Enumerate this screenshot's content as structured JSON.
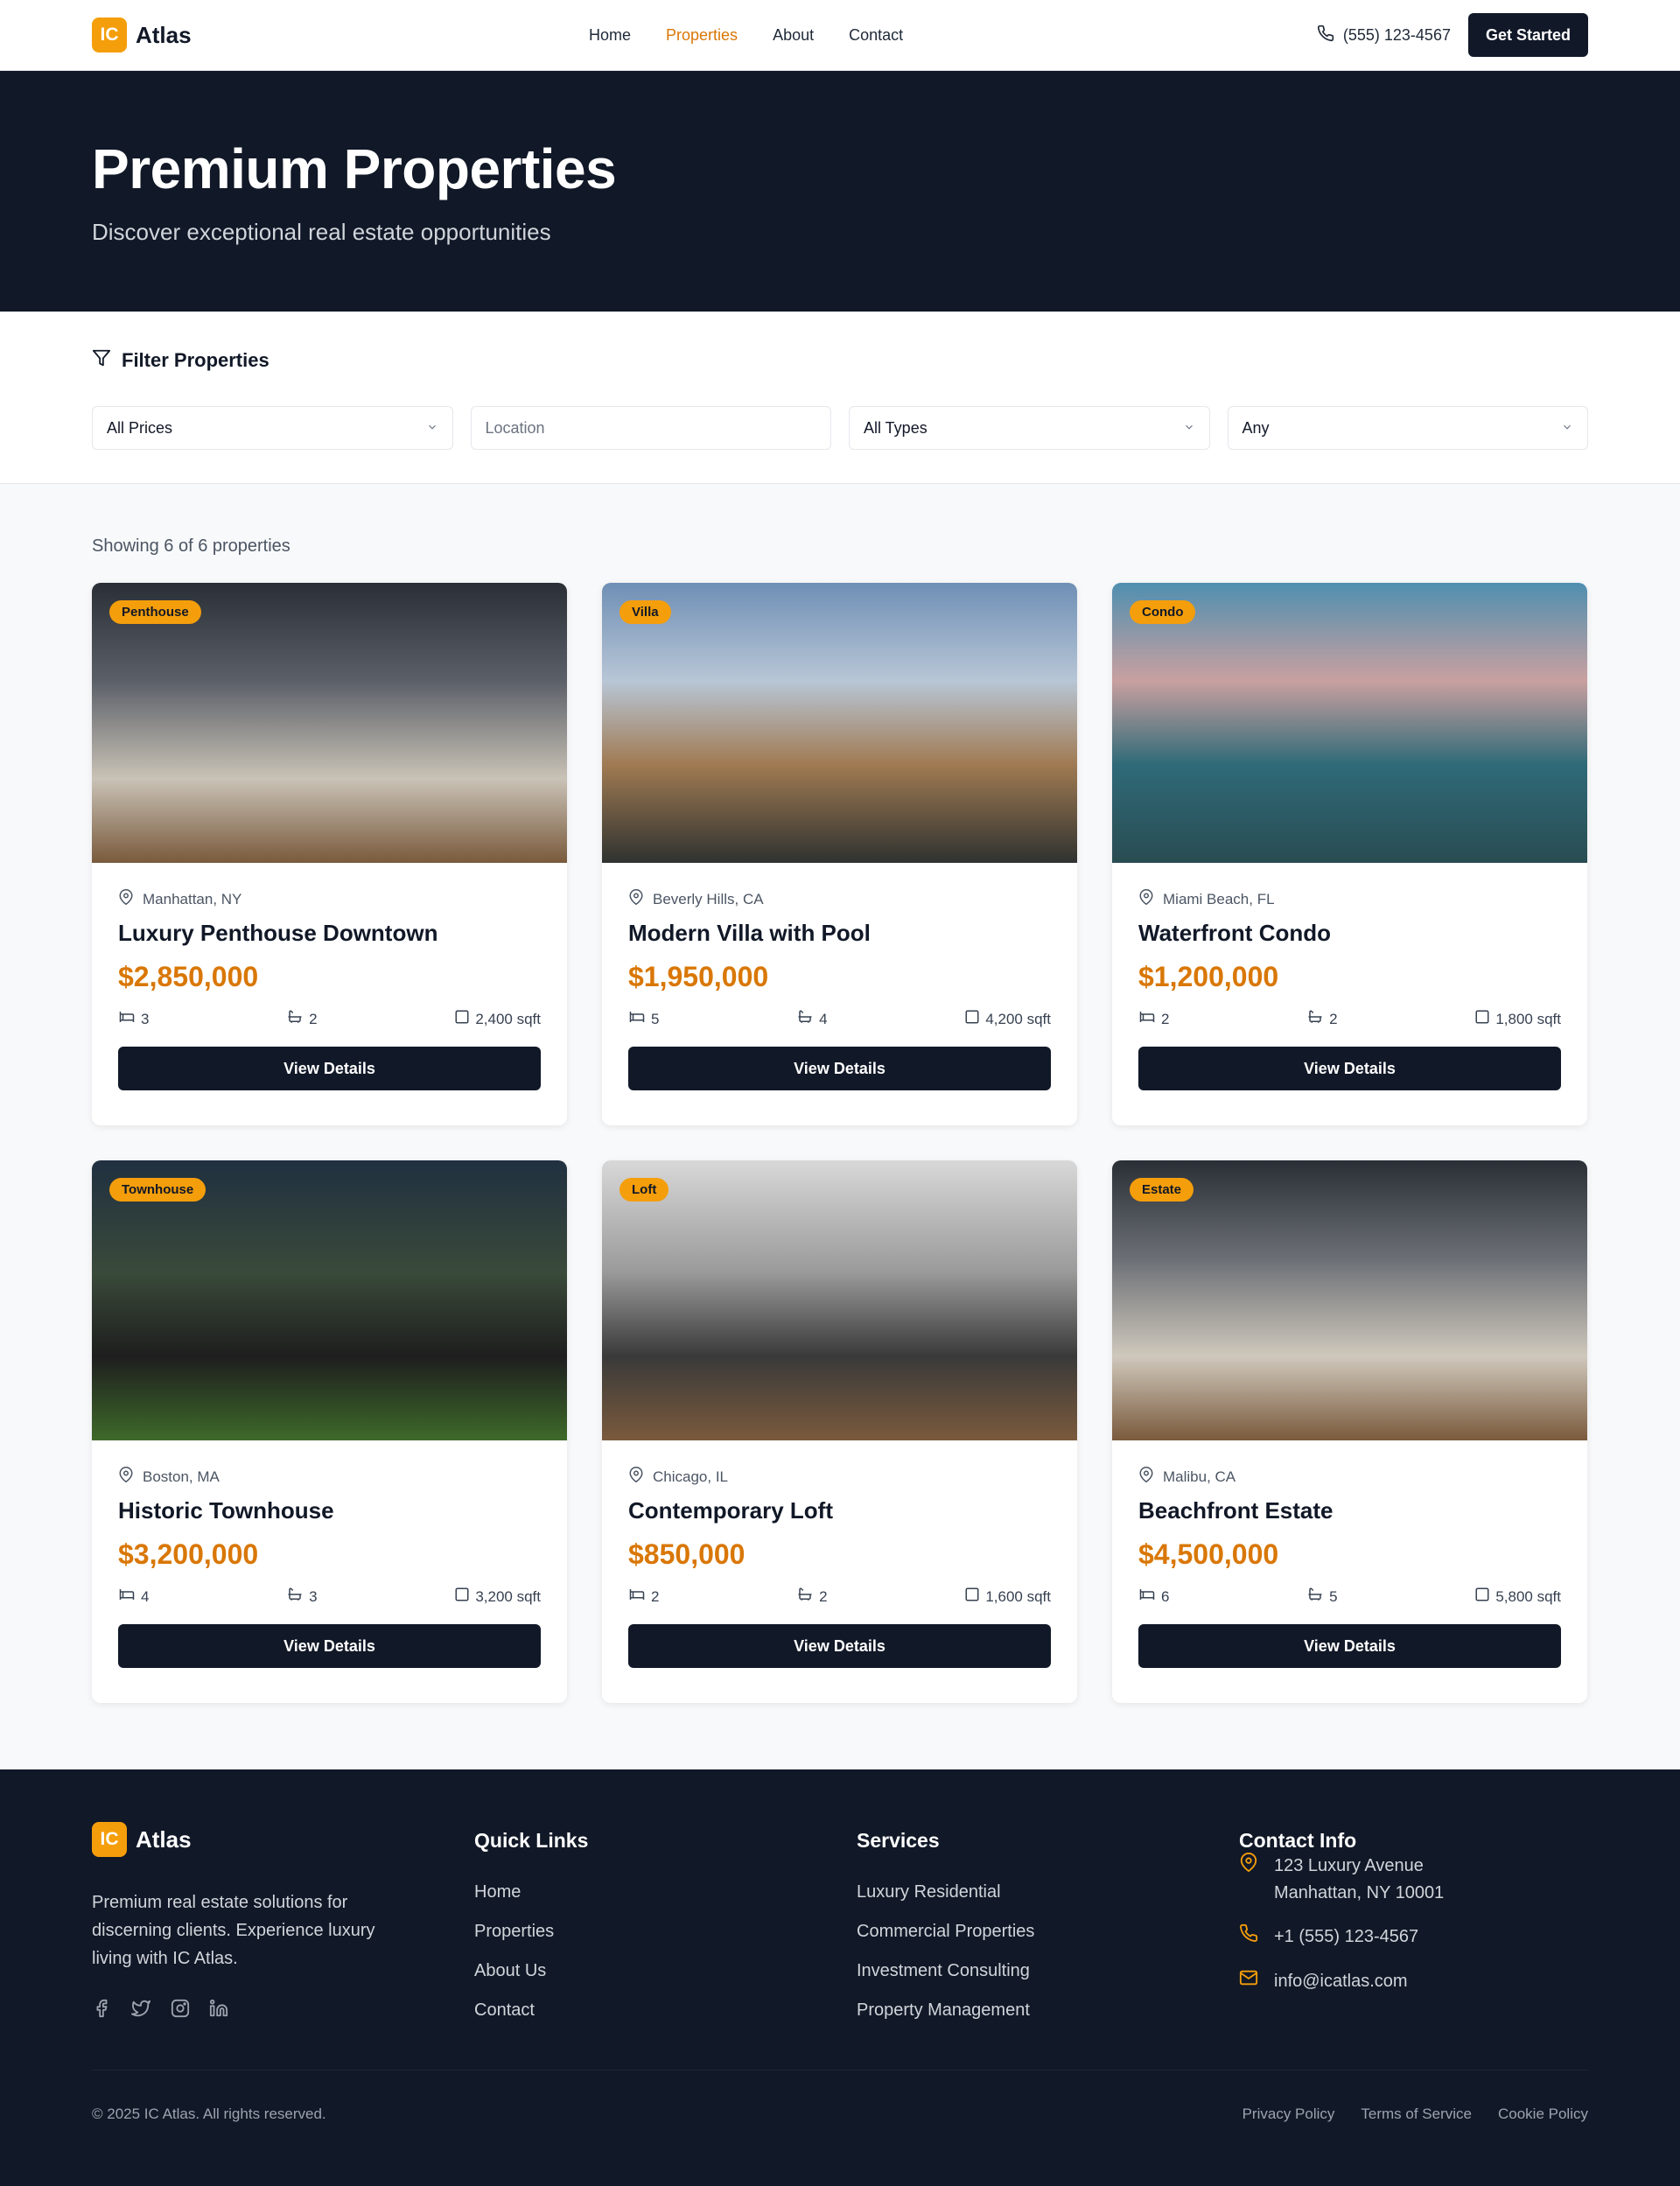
{
  "header": {
    "logo_badge": "IC",
    "logo_text": "Atlas",
    "nav": [
      "Home",
      "Properties",
      "About",
      "Contact"
    ],
    "active_nav": "Properties",
    "phone": "(555) 123-4567",
    "cta": "Get Started"
  },
  "hero": {
    "title": "Premium Properties",
    "subtitle": "Discover exceptional real estate opportunities"
  },
  "filter": {
    "title": "Filter Properties",
    "price": "All Prices",
    "location_placeholder": "Location",
    "type": "All Types",
    "bedrooms": "Any"
  },
  "listing": {
    "count_text": "Showing 6 of 6 properties",
    "cards": [
      {
        "badge": "Penthouse",
        "location": "Manhattan, NY",
        "title": "Luxury Penthouse Downtown",
        "price": "$2,850,000",
        "beds": "3",
        "baths": "2",
        "sqft": "2,400 sqft",
        "cta": "View Details"
      },
      {
        "badge": "Villa",
        "location": "Beverly Hills, CA",
        "title": "Modern Villa with Pool",
        "price": "$1,950,000",
        "beds": "5",
        "baths": "4",
        "sqft": "4,200 sqft",
        "cta": "View Details"
      },
      {
        "badge": "Condo",
        "location": "Miami Beach, FL",
        "title": "Waterfront Condo",
        "price": "$1,200,000",
        "beds": "2",
        "baths": "2",
        "sqft": "1,800 sqft",
        "cta": "View Details"
      },
      {
        "badge": "Townhouse",
        "location": "Boston, MA",
        "title": "Historic Townhouse",
        "price": "$3,200,000",
        "beds": "4",
        "baths": "3",
        "sqft": "3,200 sqft",
        "cta": "View Details"
      },
      {
        "badge": "Loft",
        "location": "Chicago, IL",
        "title": "Contemporary Loft",
        "price": "$850,000",
        "beds": "2",
        "baths": "2",
        "sqft": "1,600 sqft",
        "cta": "View Details"
      },
      {
        "badge": "Estate",
        "location": "Malibu, CA",
        "title": "Beachfront Estate",
        "price": "$4,500,000",
        "beds": "6",
        "baths": "5",
        "sqft": "5,800 sqft",
        "cta": "View Details"
      }
    ]
  },
  "footer": {
    "logo_badge": "IC",
    "logo_text": "Atlas",
    "about": "Premium real estate solutions for discerning clients. Experience luxury living with IC Atlas.",
    "quick_links_title": "Quick Links",
    "quick_links": [
      "Home",
      "Properties",
      "About Us",
      "Contact"
    ],
    "services_title": "Services",
    "services": [
      "Luxury Residential",
      "Commercial Properties",
      "Investment Consulting",
      "Property Management"
    ],
    "contact_title": "Contact Info",
    "address_line1": "123 Luxury Avenue",
    "address_line2": "Manhattan, NY 10001",
    "phone": "+1 (555) 123-4567",
    "email": "info@icatlas.com",
    "copyright": "© 2025 IC Atlas. All rights reserved.",
    "legal": [
      "Privacy Policy",
      "Terms of Service",
      "Cookie Policy"
    ]
  },
  "colors": {
    "accent": "#f59e0b",
    "price": "#d97706",
    "dark": "#111827"
  }
}
